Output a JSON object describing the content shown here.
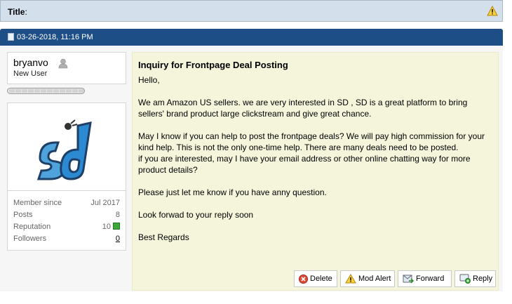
{
  "title_bar": {
    "label": "Title",
    "colon": ":",
    "icon": "warning-icon"
  },
  "post": {
    "date": "03-26-2018, 11:16 PM"
  },
  "user": {
    "name": "bryanvo",
    "rank": "New User",
    "stats": [
      {
        "label": "Member since",
        "value": "Jul 2017"
      },
      {
        "label": "Posts",
        "value": "8"
      },
      {
        "label": "Reputation",
        "value": "10"
      },
      {
        "label": "Followers",
        "value": "0"
      }
    ]
  },
  "message": {
    "title": "Inquiry for Frontpage Deal Posting",
    "greeting": "Hello,",
    "p1": "We am Amazon US sellers. we are very interested in SD , SD is a great platform to bring sellers' brand product large clickstream and give great chance.",
    "p2": "May I know if you can help to post the frontpage deals? We will pay high commission for your kind help. This is not the only one-time help. There are many deals need to be posted.",
    "p3": "if you are interested, may I have your email address or other online chatting way for more product details?",
    "p4": "Please just let me know if you have anny question.",
    "p5": "Look forwad to your reply soon",
    "p6": "Best Regards"
  },
  "buttons": {
    "delete": "Delete",
    "mod_alert": "Mod Alert",
    "forward": "Forward",
    "reply": "Reply"
  },
  "colors": {
    "header_blue": "#1d4f86",
    "title_bar": "#d3dfeb",
    "message_bg": "#f5f5dc"
  }
}
